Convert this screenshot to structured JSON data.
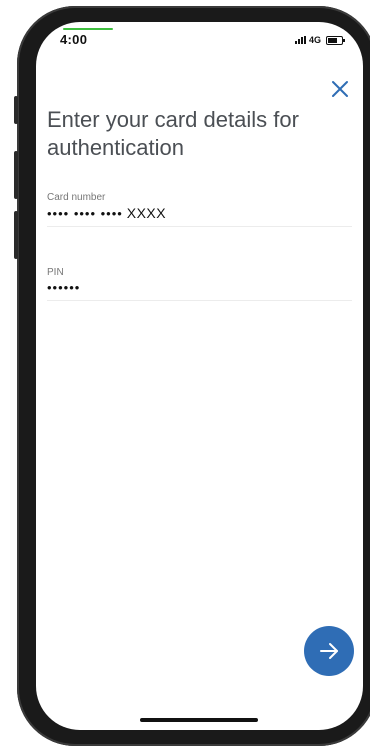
{
  "status_bar": {
    "time": "4:00",
    "network": "4G"
  },
  "page": {
    "title": "Enter your card details for authentication"
  },
  "card_number": {
    "label": "Card number",
    "masked_prefix": "•••• •••• ••••",
    "last_digits": "XXXX"
  },
  "pin": {
    "label": "PIN",
    "masked_value": "••••••"
  },
  "icons": {
    "close": "close-icon",
    "next": "arrow-right-icon"
  },
  "colors": {
    "accent": "#2f6db5",
    "title_text": "#4b4f54",
    "frame": "#1a1a1a"
  }
}
